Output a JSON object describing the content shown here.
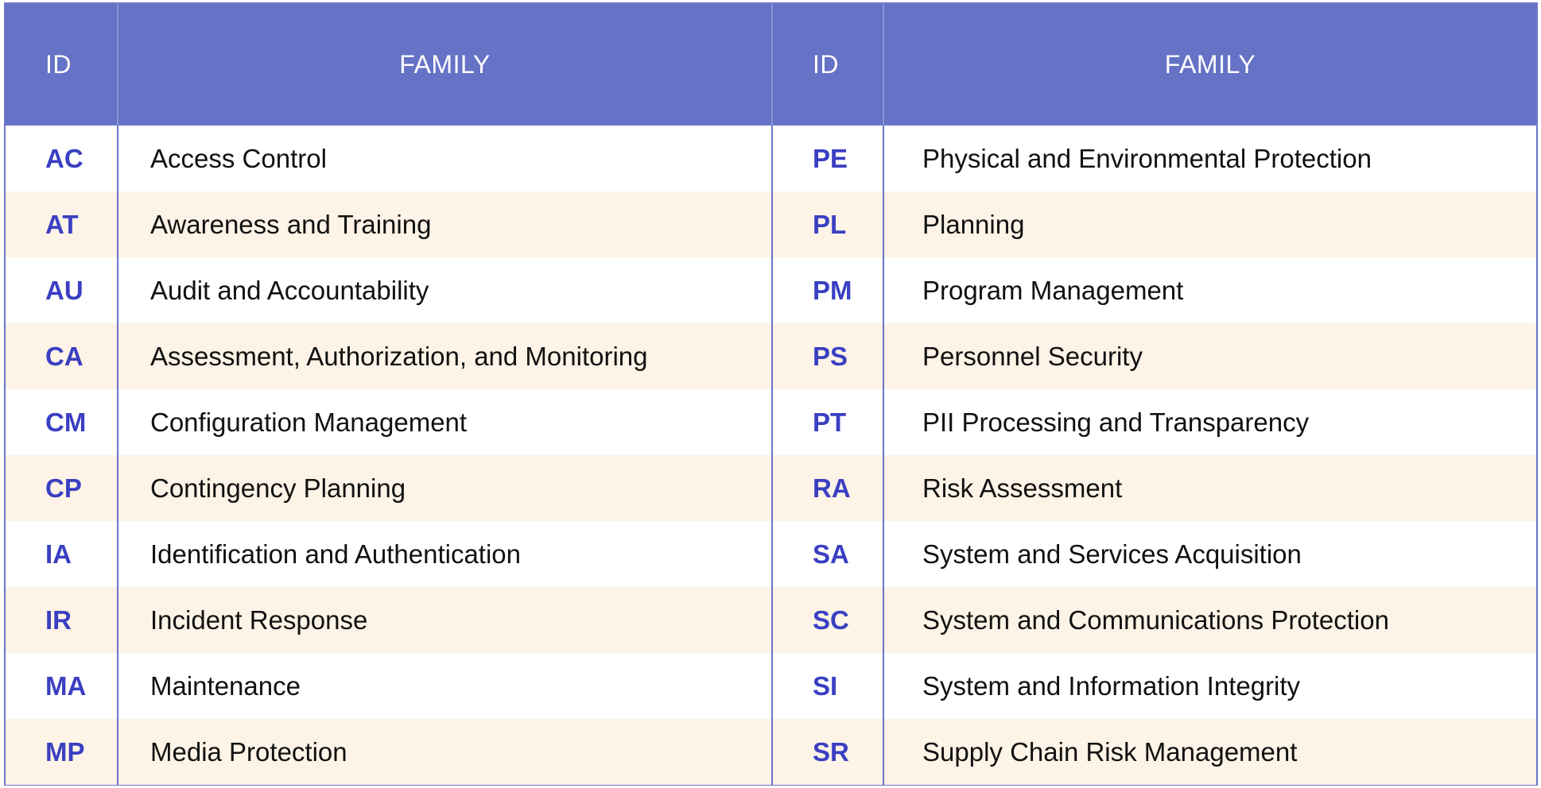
{
  "header": {
    "left_id": "ID",
    "left_family": "FAMILY",
    "right_id": "ID",
    "right_family": "FAMILY"
  },
  "colors": {
    "header_bg": "#6572c6",
    "id_text": "#3a3fc2",
    "stripe": "#fdf3e6",
    "border": "#6b76c9"
  },
  "rows": [
    {
      "left": {
        "id": "AC",
        "family": "Access Control"
      },
      "right": {
        "id": "PE",
        "family": "Physical and Environmental Protection"
      }
    },
    {
      "left": {
        "id": "AT",
        "family": "Awareness and Training"
      },
      "right": {
        "id": "PL",
        "family": "Planning"
      }
    },
    {
      "left": {
        "id": "AU",
        "family": "Audit and Accountability"
      },
      "right": {
        "id": "PM",
        "family": "Program Management"
      }
    },
    {
      "left": {
        "id": "CA",
        "family": "Assessment, Authorization, and Monitoring"
      },
      "right": {
        "id": "PS",
        "family": "Personnel Security"
      }
    },
    {
      "left": {
        "id": "CM",
        "family": "Configuration Management"
      },
      "right": {
        "id": "PT",
        "family": "PII Processing and Transparency"
      }
    },
    {
      "left": {
        "id": "CP",
        "family": "Contingency Planning"
      },
      "right": {
        "id": "RA",
        "family": "Risk Assessment"
      }
    },
    {
      "left": {
        "id": "IA",
        "family": "Identification and Authentication"
      },
      "right": {
        "id": "SA",
        "family": "System and Services Acquisition"
      }
    },
    {
      "left": {
        "id": "IR",
        "family": "Incident Response"
      },
      "right": {
        "id": "SC",
        "family": "System and Communications Protection"
      }
    },
    {
      "left": {
        "id": "MA",
        "family": "Maintenance"
      },
      "right": {
        "id": "SI",
        "family": "System and Information Integrity"
      }
    },
    {
      "left": {
        "id": "MP",
        "family": "Media Protection"
      },
      "right": {
        "id": "SR",
        "family": "Supply Chain Risk Management"
      }
    }
  ]
}
